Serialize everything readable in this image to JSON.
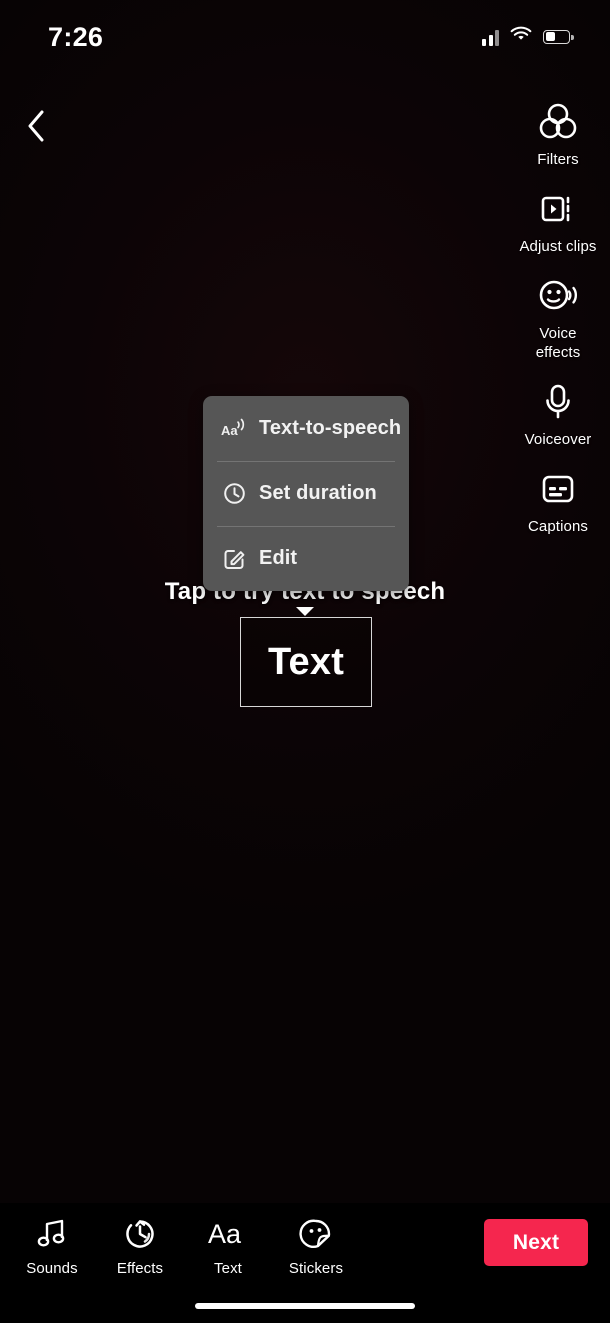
{
  "status_bar": {
    "time": "7:26",
    "cellular_icon": "cellular-signal-icon",
    "wifi_icon": "wifi-icon",
    "battery_icon": "battery-low-icon",
    "battery_level_pct": 38
  },
  "nav": {
    "back_icon": "chevron-left-icon"
  },
  "right_rail": {
    "items": [
      {
        "label": "Filters",
        "icon": "filters-icon"
      },
      {
        "label": "Adjust clips",
        "icon": "adjust-clips-icon"
      },
      {
        "label": "Voice\neffects",
        "icon": "voice-effects-icon",
        "line1": "Voice",
        "line2": "effects"
      },
      {
        "label": "Voiceover",
        "icon": "microphone-icon"
      },
      {
        "label": "Captions",
        "icon": "captions-icon"
      }
    ]
  },
  "context_menu": {
    "items": [
      {
        "label": "Text-to-speech",
        "icon": "text-to-speech-icon"
      },
      {
        "label": "Set duration",
        "icon": "clock-icon"
      },
      {
        "label": "Edit",
        "icon": "edit-pencil-icon"
      }
    ]
  },
  "tooltip": {
    "text": "Tap to try text to speech"
  },
  "text_sticker": {
    "value": "Text"
  },
  "bottom_bar": {
    "tools": [
      {
        "label": "Sounds",
        "icon": "music-note-icon"
      },
      {
        "label": "Effects",
        "icon": "effects-timer-icon"
      },
      {
        "label": "Text",
        "icon": "text-aa-icon"
      },
      {
        "label": "Stickers",
        "icon": "sticker-smiley-icon"
      }
    ],
    "next_label": "Next",
    "next_color": "#F5264E"
  },
  "colors": {
    "accent": "#F5264E",
    "menu_background": "#565656",
    "canvas_background": "#0b0406",
    "text_primary": "#FFFFFF"
  }
}
